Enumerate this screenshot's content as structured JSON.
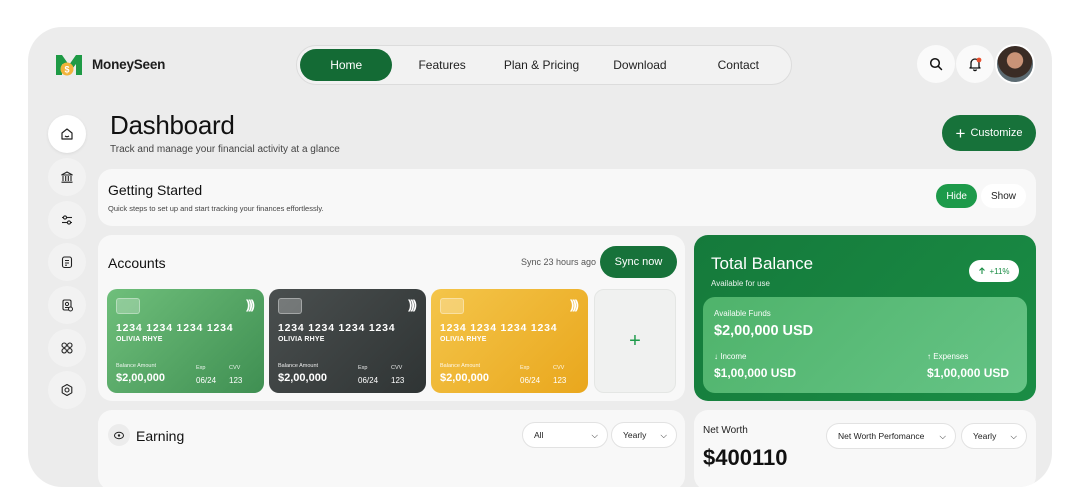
{
  "brand": {
    "name": "MoneySeen",
    "accent": "#17723a",
    "accent_light": "#1d9a4a"
  },
  "nav": {
    "items": [
      "Home",
      "Features",
      "Plan & Pricing",
      "Download",
      "Contact"
    ],
    "active": "Home"
  },
  "header_icons": [
    "search-icon",
    "bell-icon",
    "avatar"
  ],
  "sidebar": {
    "icons": [
      "home-icon",
      "bank-icon",
      "sliders-icon",
      "document-icon",
      "receipt-icon",
      "apps-icon",
      "settings-icon"
    ],
    "active": "home-icon"
  },
  "page": {
    "title": "Dashboard",
    "subtitle": "Track and manage your financial activity at a glance",
    "customize_label": "Customize"
  },
  "getting_started": {
    "title": "Getting Started",
    "subtitle": "Quick steps to set up and start tracking your finances effortlessly.",
    "hide_label": "Hide",
    "show_label": "Show",
    "selected": "Hide"
  },
  "accounts": {
    "title": "Accounts",
    "sync_text": "Sync 23 hours ago",
    "sync_button": "Sync now",
    "add_label": "+",
    "cards": [
      {
        "number": "1234 1234 1234 1234",
        "holder": "OLIVIA RHYE",
        "balance_label": "Balance Amount",
        "balance": "$2,00,000",
        "exp_label": "Exp",
        "exp": "06/24",
        "cvv_label": "CVV",
        "cvv": "123",
        "color": "#55a867"
      },
      {
        "number": "1234 1234 1234 1234",
        "holder": "OLIVIA RHYE",
        "balance_label": "Balance Amount",
        "balance": "$2,00,000",
        "exp_label": "Exp",
        "exp": "06/24",
        "cvv_label": "CVV",
        "cvv": "123",
        "color": "#3b4141"
      },
      {
        "number": "1234 1234 1234 1234",
        "holder": "OLIVIA RHYE",
        "balance_label": "Balance Amount",
        "balance": "$2,00,000",
        "exp_label": "Exp",
        "exp": "06/24",
        "cvv_label": "CVV",
        "cvv": "123",
        "color": "#efb431"
      }
    ]
  },
  "total_balance": {
    "title": "Total Balance",
    "subtitle": "Available for use",
    "badge": "+11%",
    "available_label": "Available Funds",
    "available_value": "$2,00,000 USD",
    "income_label": "Income",
    "income_value": "$1,00,000 USD",
    "expenses_label": "Expenses",
    "expenses_value": "$1,00,000 USD"
  },
  "earning": {
    "title": "Earning",
    "filter_all": "All",
    "filter_period": "Yearly"
  },
  "net_worth": {
    "label": "Net Worth",
    "value": "$400110",
    "filter_metric": "Net Worth Perfomance",
    "filter_period": "Yearly"
  }
}
